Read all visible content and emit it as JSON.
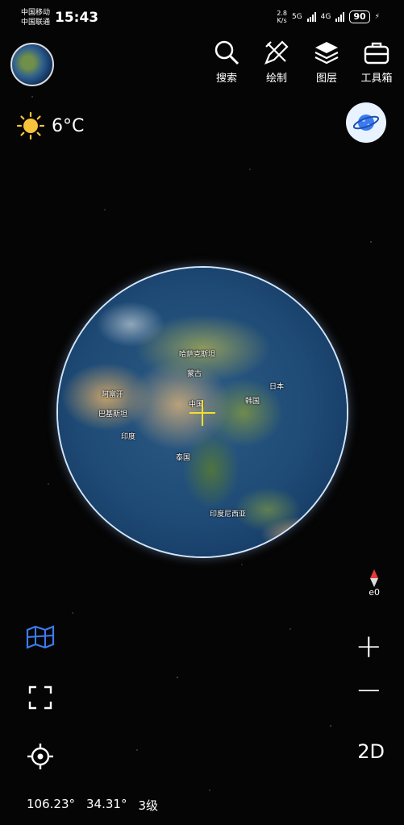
{
  "status_bar": {
    "carrier1": "中国移动",
    "carrier2": "中国联通",
    "time": "15:43",
    "net_speed_value": "2.8",
    "net_speed_unit": "K/s",
    "network1": "5G",
    "network2": "4G",
    "battery": "90"
  },
  "toolbar": {
    "items": [
      {
        "label": "搜索",
        "icon": "search-icon"
      },
      {
        "label": "绘制",
        "icon": "draw-icon"
      },
      {
        "label": "图层",
        "icon": "layers-icon"
      },
      {
        "label": "工具箱",
        "icon": "toolbox-icon"
      }
    ]
  },
  "weather": {
    "temperature": "6°C",
    "icon": "sun-icon"
  },
  "globe": {
    "labels": [
      "中国",
      "蒙古",
      "韩国",
      "日本",
      "印度",
      "泰国",
      "印度尼西亚",
      "哈萨克斯坦",
      "巴基斯坦",
      "阿富汗"
    ]
  },
  "compass": {
    "heading": "e0"
  },
  "controls": {
    "zoom_in": "+",
    "zoom_out": "−",
    "view_mode": "2D"
  },
  "coordinates": {
    "longitude": "106.23°",
    "latitude": "34.31°",
    "level": "3级"
  },
  "colors": {
    "accent_blue": "#3b7bf0",
    "crosshair": "#f3e02a",
    "compass_red": "#e53935"
  }
}
